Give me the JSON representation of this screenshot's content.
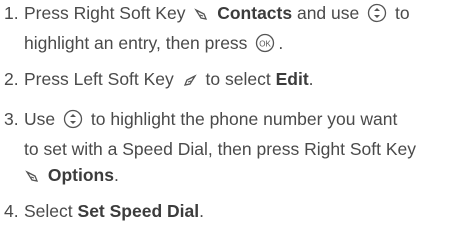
{
  "steps": [
    {
      "number": "1.",
      "line1_pre": "Press Right Soft Key",
      "line1_bold": "Contacts",
      "line1_mid": "and use",
      "line1_post": "to",
      "line2_pre": "highlight an entry, then press",
      "line2_post": ".",
      "icons": [
        "right-soft-key-icon",
        "navigation-key-icon",
        "ok-key-icon"
      ]
    },
    {
      "number": "2.",
      "pre": "Press Left Soft Key",
      "mid": "to select",
      "bold": "Edit",
      "post": ".",
      "icons": [
        "left-soft-key-icon"
      ]
    },
    {
      "number": "3.",
      "line1_pre": "Use",
      "line1_post": "to highlight the phone number you want",
      "line2": "to set with a Speed Dial, then press Right Soft Key",
      "line3_bold": "Options",
      "line3_post": ".",
      "icons": [
        "navigation-key-icon",
        "right-soft-key-icon"
      ]
    },
    {
      "number": "4.",
      "pre": "Select",
      "bold": "Set Speed Dial",
      "post": "."
    }
  ]
}
